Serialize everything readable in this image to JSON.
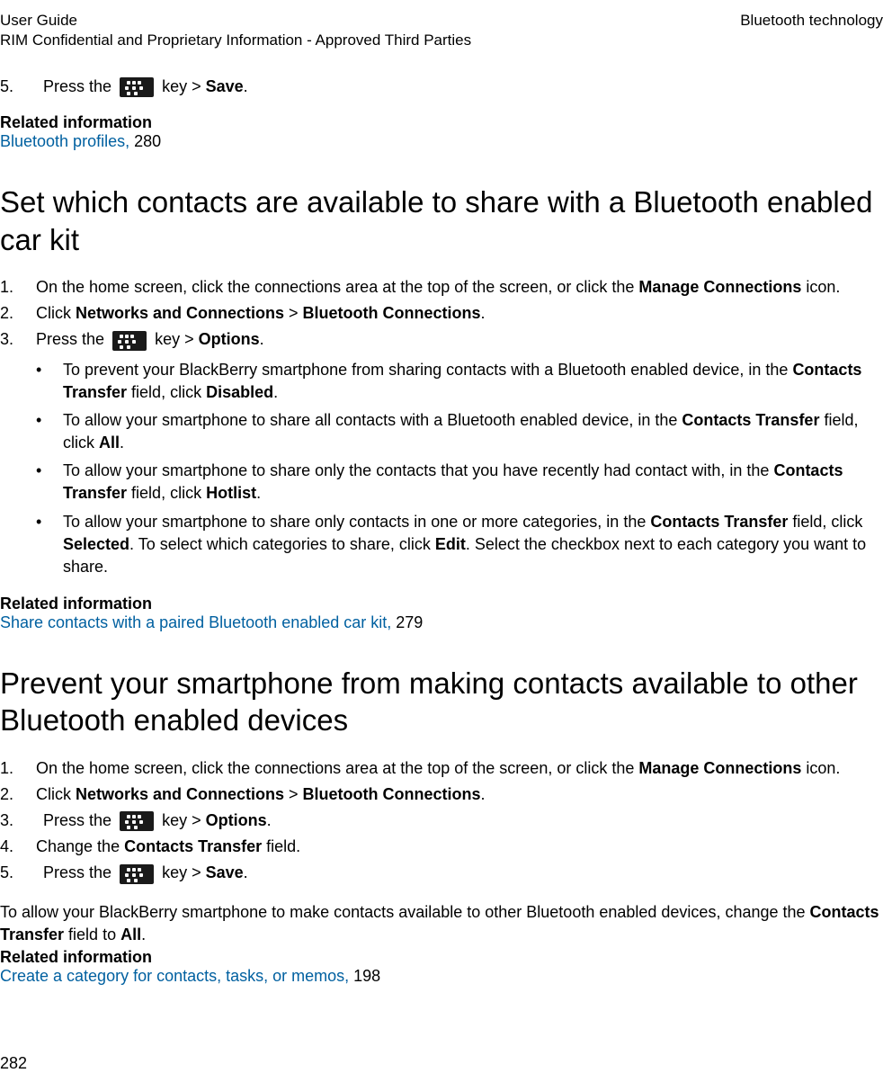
{
  "header": {
    "left_line1": "User Guide",
    "left_line2": "RIM Confidential and Proprietary Information - Approved Third Parties",
    "right": "Bluetooth technology"
  },
  "step5": {
    "num": "5.",
    "before": "Press the ",
    "mid": " key > ",
    "after_bold": "Save",
    "period": "."
  },
  "related1": {
    "heading": "Related information",
    "link_text": "Bluetooth profiles, ",
    "link_page": "280"
  },
  "section1": {
    "title": "Set which contacts are available to share with a Bluetooth enabled car kit",
    "steps": [
      {
        "num": "1.",
        "plain": "On the home screen, click the connections area at the top of the screen, or click the ",
        "bold_tail": "Manage Connections",
        "after_tail": " icon."
      },
      {
        "num": "2.",
        "plain": "Click ",
        "bold_a": "Networks and Connections",
        "mid": " > ",
        "bold_b": "Bluetooth Connections",
        "after": "."
      },
      {
        "num": "3.",
        "before": "Press the ",
        "mid": " key > ",
        "bold": "Options",
        "after": "."
      }
    ],
    "bullets": [
      {
        "pre": "To prevent your BlackBerry smartphone from sharing contacts with a Bluetooth enabled device, in the ",
        "b1": "Contacts Transfer",
        "mid1": " field, click ",
        "b2": "Disabled",
        "post": "."
      },
      {
        "pre": "To allow your smartphone to share all contacts with a Bluetooth enabled device, in the ",
        "b1": "Contacts Transfer",
        "mid1": " field, click ",
        "b2": "All",
        "post": "."
      },
      {
        "pre": "To allow your smartphone to share only the contacts that you have recently had contact with, in the ",
        "b1": "Contacts Transfer",
        "mid1": " field, click ",
        "b2": "Hotlist",
        "post": "."
      },
      {
        "pre": "To allow your smartphone to share only contacts in one or more categories, in the ",
        "b1": "Contacts Transfer",
        "mid1": " field, click ",
        "b2": "Selected",
        "mid2": ". To select which categories to share, click ",
        "b3": "Edit",
        "post": ". Select the checkbox next to each category you want to share."
      }
    ],
    "related": {
      "heading": "Related information",
      "link_text": "Share contacts with a paired Bluetooth enabled car kit, ",
      "link_page": "279"
    }
  },
  "section2": {
    "title": "Prevent your smartphone from making contacts available to other Bluetooth enabled devices",
    "steps": [
      {
        "num": "1.",
        "plain": "On the home screen, click the connections area at the top of the screen, or click the ",
        "bold_tail": "Manage Connections",
        "after_tail": " icon."
      },
      {
        "num": "2.",
        "plain": "Click ",
        "bold_a": "Networks and Connections",
        "mid": " > ",
        "bold_b": "Bluetooth Connections",
        "after": "."
      },
      {
        "num": "3.",
        "before": "Press the ",
        "mid": " key > ",
        "bold": "Options",
        "after": "."
      },
      {
        "num": "4.",
        "plain": "Change the ",
        "bold_a": "Contacts Transfer",
        "after": " field."
      },
      {
        "num": "5.",
        "before": "Press the ",
        "mid": " key > ",
        "bold": "Save",
        "after": "."
      }
    ],
    "para": {
      "pre": "To allow your BlackBerry smartphone to make contacts available to other Bluetooth enabled devices, change the ",
      "b1": "Contacts Transfer",
      "mid": " field to ",
      "b2": "All",
      "post": "."
    },
    "related": {
      "heading": "Related information",
      "link_text": "Create a category for contacts, tasks, or memos, ",
      "link_page": "198"
    }
  },
  "footer": {
    "page": "282"
  }
}
